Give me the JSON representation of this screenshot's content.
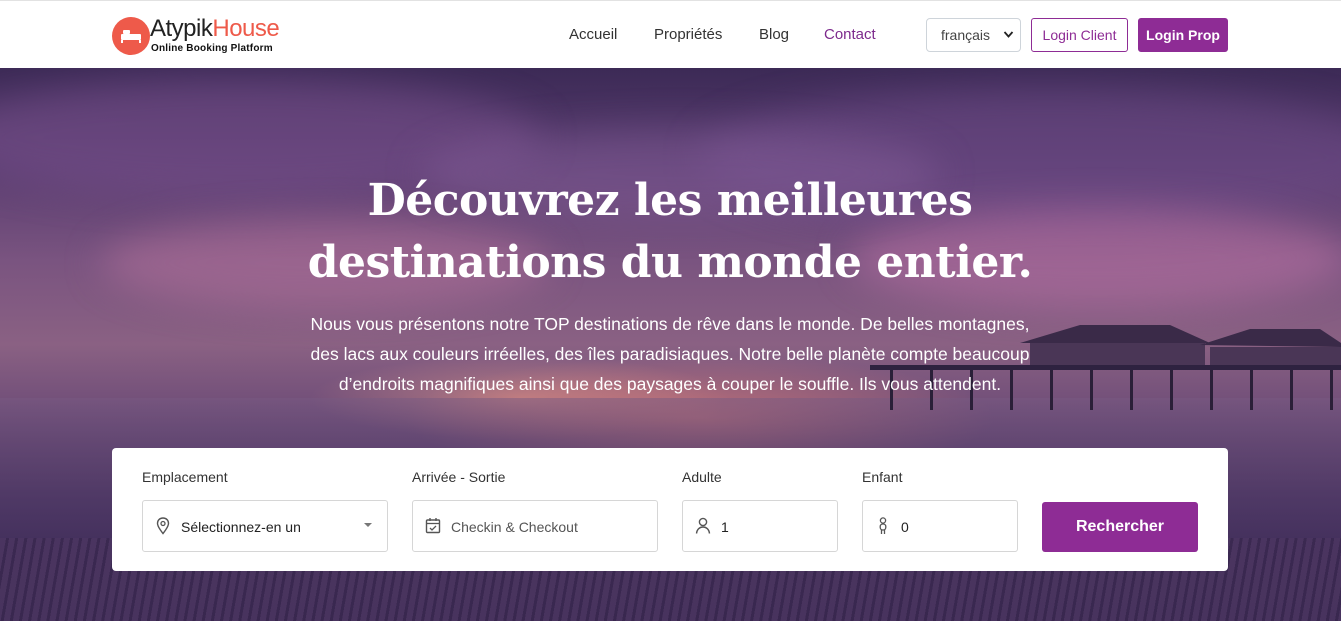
{
  "brand": {
    "name_part1": "Atypik",
    "name_part2": "House",
    "tagline": "Online Booking Platform",
    "accent_color": "#ee5a4a"
  },
  "nav": {
    "items": [
      {
        "label": "Accueil",
        "active": false
      },
      {
        "label": "Propriétés",
        "active": false
      },
      {
        "label": "Blog",
        "active": false
      },
      {
        "label": "Contact",
        "active": true
      }
    ]
  },
  "header": {
    "language": {
      "selected": "français",
      "icon": "chevron-down-icon"
    },
    "login_client_label": "Login Client",
    "login_prop_label": "Login Prop",
    "primary_color": "#8e2c95"
  },
  "hero": {
    "title_line1": "Découvrez les meilleures",
    "title_line2": "destinations du monde entier.",
    "text_line1": "Nous vous présentons notre TOP destinations de rêve dans le monde. De belles montagnes,",
    "text_line2": "des lacs aux couleurs irréelles, des îles paradisiaques. Notre belle planète compte beaucoup",
    "text_line3": "d’endroits magnifiques ainsi que des paysages à couper le souffle. Ils vous attendent."
  },
  "search": {
    "location": {
      "label": "Emplacement",
      "value": "Sélectionnez-en un",
      "icon": "map-pin-icon"
    },
    "dates": {
      "label": "Arrivée - Sortie",
      "placeholder": "Checkin & Checkout",
      "icon": "calendar-icon"
    },
    "adults": {
      "label": "Adulte",
      "value": "1",
      "icon": "user-icon"
    },
    "children": {
      "label": "Enfant",
      "value": "0",
      "icon": "child-icon"
    },
    "submit_label": "Rechercher"
  }
}
